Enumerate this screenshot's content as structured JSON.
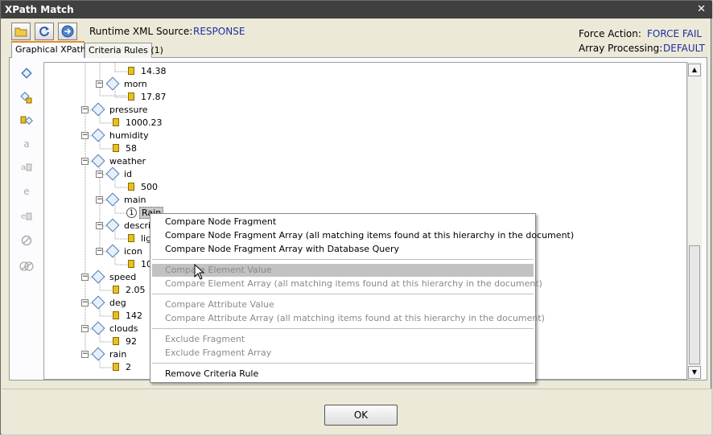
{
  "window": {
    "title": "XPath Match",
    "close_glyph": "✕"
  },
  "toolbar": {
    "source_label": "Runtime XML Source:",
    "source_value": "RESPONSE",
    "force_action_label": "Force Action:",
    "force_action_value": "FORCE FAIL",
    "array_processing_label": "Array Processing:",
    "array_processing_value": "DEFAULT"
  },
  "tabs": [
    {
      "label": "Graphical XPath",
      "active": true
    },
    {
      "label": "Criteria Rules (1)",
      "active": false
    }
  ],
  "tree": {
    "rows": [
      {
        "type": "leaf",
        "text": "14.38"
      },
      {
        "type": "node",
        "text": "morn"
      },
      {
        "type": "leaf",
        "text": "17.87"
      },
      {
        "type": "node",
        "text": "pressure"
      },
      {
        "type": "leaf",
        "text": "1000.23"
      },
      {
        "type": "node",
        "text": "humidity"
      },
      {
        "type": "leaf",
        "text": "58"
      },
      {
        "type": "node",
        "text": "weather"
      },
      {
        "type": "node",
        "text": "id"
      },
      {
        "type": "leaf",
        "text": "500"
      },
      {
        "type": "node",
        "text": "main"
      },
      {
        "type": "selected",
        "badge": "1",
        "text": "Rain"
      },
      {
        "type": "node",
        "text": "descri"
      },
      {
        "type": "leaf",
        "text": "lig"
      },
      {
        "type": "node",
        "text": "icon"
      },
      {
        "type": "leaf",
        "text": "10"
      },
      {
        "type": "node",
        "text": "speed"
      },
      {
        "type": "leaf",
        "text": "2.05"
      },
      {
        "type": "node",
        "text": "deg"
      },
      {
        "type": "leaf",
        "text": "142"
      },
      {
        "type": "node",
        "text": "clouds"
      },
      {
        "type": "leaf",
        "text": "92"
      },
      {
        "type": "node",
        "text": "rain"
      },
      {
        "type": "leaf",
        "text": "2"
      }
    ]
  },
  "context_menu": {
    "items": [
      {
        "label": "Compare Node Fragment",
        "enabled": true
      },
      {
        "label": "Compare Node Fragment Array (all matching items found at this hierarchy in the document)",
        "enabled": true
      },
      {
        "label": "Compare Node Fragment Array with Database Query",
        "enabled": true
      },
      {
        "label": "Compare Element Value",
        "enabled": false
      },
      {
        "label": "Compare Element Array (all matching items found at this hierarchy in the document)",
        "enabled": false
      },
      {
        "label": "Compare Attribute Value",
        "enabled": false
      },
      {
        "label": "Compare Attribute Array (all matching items found at this hierarchy in the document)",
        "enabled": false
      },
      {
        "label": "Exclude Fragment",
        "enabled": false
      },
      {
        "label": "Exclude Fragment Array",
        "enabled": false
      },
      {
        "label": "Remove Criteria Rule",
        "enabled": true
      }
    ]
  },
  "buttons": {
    "ok": "OK"
  },
  "colors": {
    "title_bar": "#404040",
    "link_blue": "#1a2fa0",
    "highlight": "#c2c2c2"
  }
}
